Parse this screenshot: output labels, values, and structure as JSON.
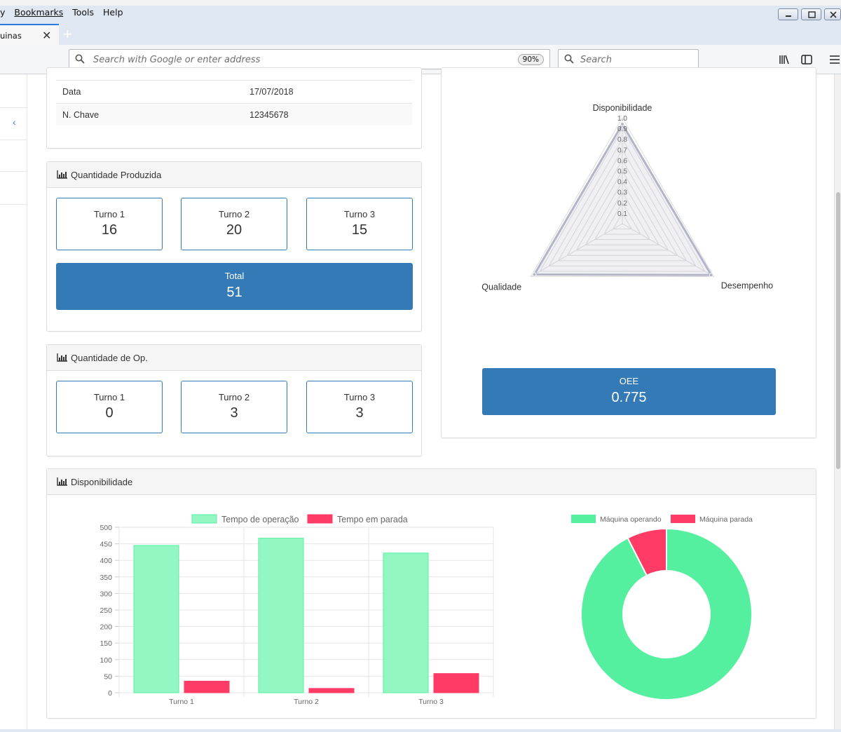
{
  "browser": {
    "menu": [
      "Bookmarks",
      "Tools",
      "Help"
    ],
    "menu_prefix": "y",
    "tab_label": "uinas",
    "url_placeholder": "Search with Google or enter address",
    "zoom": "90%",
    "search_placeholder": "Search"
  },
  "info": {
    "rows": [
      {
        "key": "Data",
        "value": "17/07/2018"
      },
      {
        "key": "N. Chave",
        "value": "12345678"
      }
    ]
  },
  "produced": {
    "title": "Quantidade Produzida",
    "shifts": [
      {
        "label": "Turno 1",
        "value": "16"
      },
      {
        "label": "Turno 2",
        "value": "20"
      },
      {
        "label": "Turno 3",
        "value": "15"
      }
    ],
    "total_label": "Total",
    "total_value": "51"
  },
  "ops": {
    "title": "Quantidade de Op.",
    "shifts": [
      {
        "label": "Turno 1",
        "value": "0"
      },
      {
        "label": "Turno 2",
        "value": "3"
      },
      {
        "label": "Turno 3",
        "value": "3"
      }
    ]
  },
  "oee": {
    "label": "OEE",
    "value": "0.775"
  },
  "availability": {
    "title": "Disponibilidade"
  },
  "colors": {
    "primary": "#337ab7",
    "green": "#55efa0",
    "green_fill": "#93f7c3",
    "red": "#ff3b66"
  },
  "chart_data": [
    {
      "type": "radar",
      "categories": [
        "Disponibilidade",
        "Desempenho",
        "Qualidade"
      ],
      "values": [
        0.94,
        0.97,
        0.96
      ],
      "scale_ticks": [
        "0.1",
        "0.2",
        "0.3",
        "0.4",
        "0.5",
        "0.6",
        "0.7",
        "0.8",
        "0.9",
        "1.0"
      ],
      "ylim": [
        0,
        1
      ]
    },
    {
      "type": "bar",
      "categories": [
        "Turno 1",
        "Turno 2",
        "Turno 3"
      ],
      "series": [
        {
          "name": "Tempo de operação",
          "values": [
            445,
            467,
            422
          ]
        },
        {
          "name": "Tempo em parada",
          "values": [
            35,
            13,
            58
          ]
        }
      ],
      "y_ticks": [
        "500",
        "450",
        "400",
        "350",
        "300",
        "250",
        "200",
        "150",
        "100",
        "50",
        "0"
      ],
      "ylim": [
        0,
        500
      ]
    },
    {
      "type": "pie",
      "series": [
        {
          "name": "Máquina operando",
          "value": 92.5
        },
        {
          "name": "Máquina parada",
          "value": 7.5
        }
      ]
    }
  ]
}
